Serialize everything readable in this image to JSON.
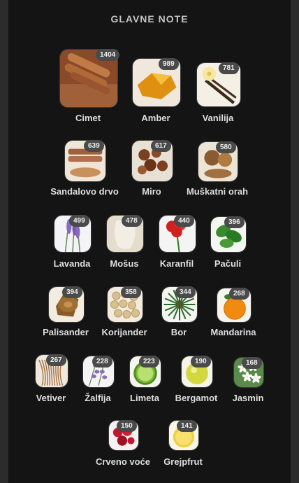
{
  "header": {
    "title": "GLAVNE NOTE"
  },
  "notes": [
    {
      "id": "cimet",
      "name": "Cimet",
      "votes": "1404",
      "icon": "cinnamon-icon",
      "bg": "#8a4a2a",
      "fg": "#c07a45"
    },
    {
      "id": "amber",
      "name": "Amber",
      "votes": "989",
      "icon": "amber-icon",
      "bg": "#f0e8dc",
      "fg": "#e09010"
    },
    {
      "id": "vanilija",
      "name": "Vanilija",
      "votes": "781",
      "icon": "vanilla-icon",
      "bg": "#f4f0e6",
      "fg": "#f5e8a0"
    },
    {
      "id": "sandalovo",
      "name": "Sandalovo drvo",
      "votes": "639",
      "icon": "sandalwood-icon",
      "bg": "#f0e6d8",
      "fg": "#a06040"
    },
    {
      "id": "miro",
      "name": "Miro",
      "votes": "617",
      "icon": "myrrh-icon",
      "bg": "#e8e0d4",
      "fg": "#7a4020"
    },
    {
      "id": "muskatni",
      "name": "Muškatni orah",
      "votes": "580",
      "icon": "nutmeg-icon",
      "bg": "#ece4d4",
      "fg": "#8a5a30"
    },
    {
      "id": "lavanda",
      "name": "Lavanda",
      "votes": "499",
      "icon": "lavender-icon",
      "bg": "#f4f4f8",
      "fg": "#8a6ac0"
    },
    {
      "id": "mosus",
      "name": "Mošus",
      "votes": "478",
      "icon": "musk-icon",
      "bg": "#e4dccc",
      "fg": "#f2eee4"
    },
    {
      "id": "karanfil",
      "name": "Karanfil",
      "votes": "440",
      "icon": "carnation-icon",
      "bg": "#f4f4f4",
      "fg": "#d02020"
    },
    {
      "id": "paculi",
      "name": "Pačuli",
      "votes": "396",
      "icon": "patchouli-icon",
      "bg": "#f4f6f0",
      "fg": "#3a8a30"
    },
    {
      "id": "palisander",
      "name": "Palisander",
      "votes": "394",
      "icon": "rosewood-icon",
      "bg": "#f2ede0",
      "fg": "#a07030"
    },
    {
      "id": "korijander",
      "name": "Korijander",
      "votes": "358",
      "icon": "coriander-icon",
      "bg": "#f2ece0",
      "fg": "#d8c090"
    },
    {
      "id": "bor",
      "name": "Bor",
      "votes": "344",
      "icon": "pine-icon",
      "bg": "#f4f4f0",
      "fg": "#2a6a2a"
    },
    {
      "id": "mandarina",
      "name": "Mandarina",
      "votes": "268",
      "icon": "mandarin-icon",
      "bg": "#f6f4ee",
      "fg": "#f08a10"
    },
    {
      "id": "vetiver",
      "name": "Vetiver",
      "votes": "267",
      "icon": "vetiver-icon",
      "bg": "#f0e8dc",
      "fg": "#a07040"
    },
    {
      "id": "zalfija",
      "name": "Žalfija",
      "votes": "228",
      "icon": "sage-icon",
      "bg": "#f4f4f4",
      "fg": "#8a70b0"
    },
    {
      "id": "limeta",
      "name": "Limeta",
      "votes": "223",
      "icon": "lime-icon",
      "bg": "#f4f6ee",
      "fg": "#78b830"
    },
    {
      "id": "bergamot",
      "name": "Bergamot",
      "votes": "190",
      "icon": "bergamot-icon",
      "bg": "#f4f4e8",
      "fg": "#d4d840"
    },
    {
      "id": "jasmin",
      "name": "Jasmin",
      "votes": "168",
      "icon": "jasmine-icon",
      "bg": "#e4ece0",
      "fg": "#ffffff"
    },
    {
      "id": "crveno",
      "name": "Crveno voće",
      "votes": "150",
      "icon": "red-fruits-icon",
      "bg": "#f6f0f0",
      "fg": "#c01830"
    },
    {
      "id": "grejpfrut",
      "name": "Grejpfrut",
      "votes": "141",
      "icon": "grapefruit-icon",
      "bg": "#fbf6e4",
      "fg": "#f0d040"
    }
  ]
}
